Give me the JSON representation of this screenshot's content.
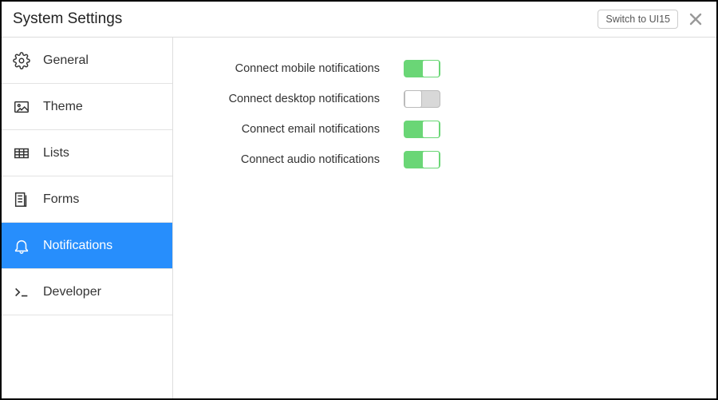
{
  "header": {
    "title": "System Settings",
    "switch_label": "Switch to UI15"
  },
  "sidebar": {
    "items": [
      {
        "icon": "gear-icon",
        "label": "General",
        "active": false
      },
      {
        "icon": "image-icon",
        "label": "Theme",
        "active": false
      },
      {
        "icon": "table-icon",
        "label": "Lists",
        "active": false
      },
      {
        "icon": "form-icon",
        "label": "Forms",
        "active": false
      },
      {
        "icon": "bell-icon",
        "label": "Notifications",
        "active": true
      },
      {
        "icon": "developer-icon",
        "label": "Developer",
        "active": false
      }
    ]
  },
  "settings": [
    {
      "label": "Connect mobile notifications",
      "on": true
    },
    {
      "label": "Connect desktop notifications",
      "on": false
    },
    {
      "label": "Connect email notifications",
      "on": true
    },
    {
      "label": "Connect audio notifications",
      "on": true
    }
  ]
}
